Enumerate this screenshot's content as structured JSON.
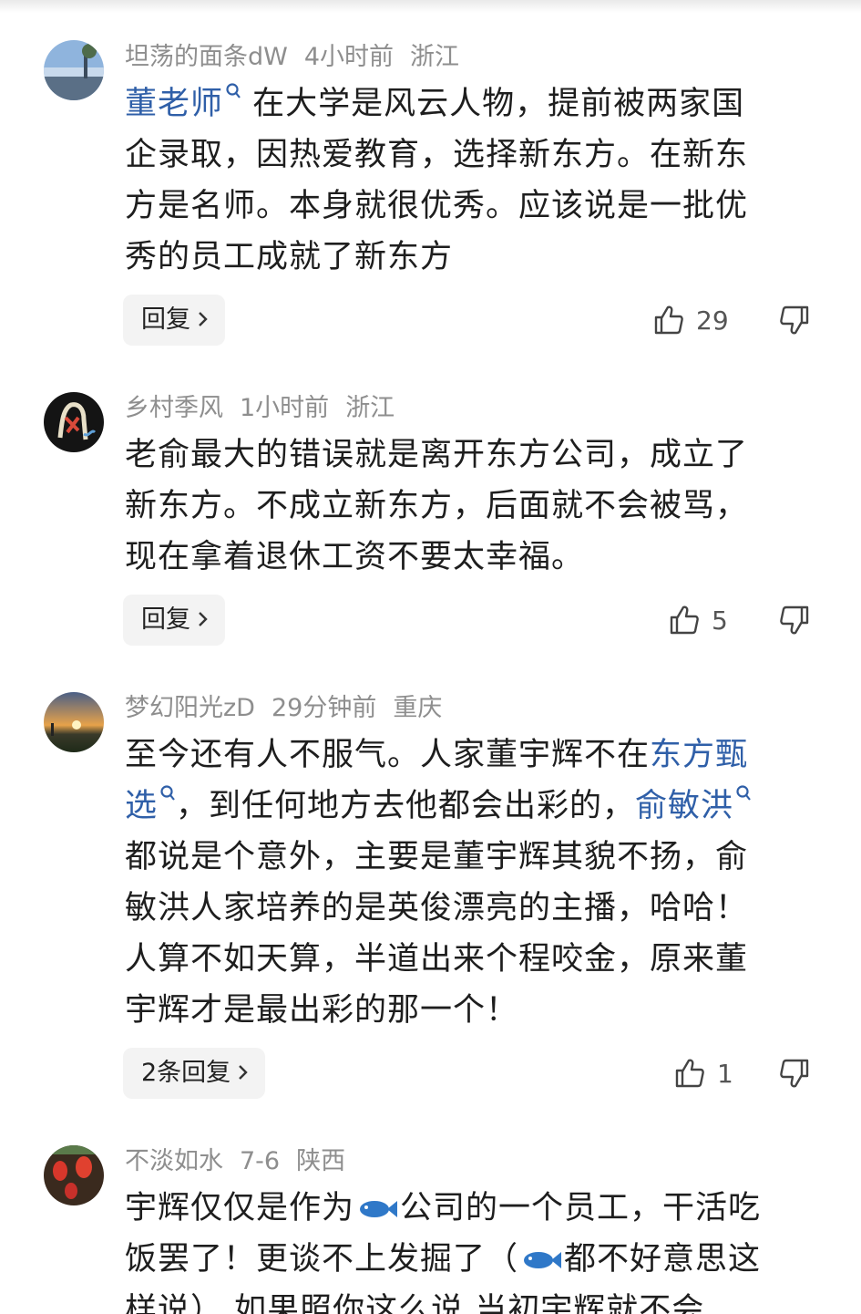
{
  "comments": [
    {
      "username": "坦荡的面条dW",
      "time": "4小时前",
      "location": "浙江",
      "link1": "董老师",
      "lines": [
        "在大学是风云人物，提前被两家国",
        "企录取，因热爱教育，选择新东方。在新东",
        "方是名师。本身就很优秀。应该说是一批优",
        "秀的员工成就了新东方"
      ],
      "reply_label": "回复",
      "likes": "29"
    },
    {
      "username": "乡村季风",
      "time": "1小时前",
      "location": "浙江",
      "lines": [
        "老俞最大的错误就是离开东方公司，成立了",
        "新东方。不成立新东方，后面就不会被骂，",
        "现在拿着退休工资不要太幸福。"
      ],
      "reply_label": "回复",
      "likes": "5"
    },
    {
      "username": "梦幻阳光zD",
      "time": "29分钟前",
      "location": "重庆",
      "line1_text": "至今还有人不服气。人家董宇辉不在",
      "line1_link": "东方甄",
      "line2_link": "选",
      "line2_text": "，到任何地方去他都会出彩的，",
      "line2_link2": "俞敏洪",
      "lines": [
        "都说是个意外，主要是董宇辉其貌不扬，俞",
        "敏洪人家培养的是英俊漂亮的主播，哈哈！",
        "人算不如天算，半道出来个程咬金，原来董",
        "宇辉才是最出彩的那一个！"
      ],
      "reply_label": "2条回复",
      "likes": "1"
    },
    {
      "username": "不淡如水",
      "time": "7-6",
      "location": "陕西",
      "line1_a": "宇辉仅仅是作为",
      "line1_b": "公司的一个员工，干活吃",
      "line2_a": "饭罢了！更谈不上发掘了（",
      "line2_b": "都不好意思这",
      "line3": "样说）  如果照你这么说  当初宇辉就不会"
    }
  ],
  "colors": {
    "link": "#2f5fa8",
    "meta": "#8e8e8e",
    "reply_bg": "#f3f3f3"
  },
  "icons": [
    "search-icon",
    "chevron-right-icon",
    "thumbs-up-icon",
    "thumbs-down-icon",
    "fish-emoji-icon"
  ]
}
